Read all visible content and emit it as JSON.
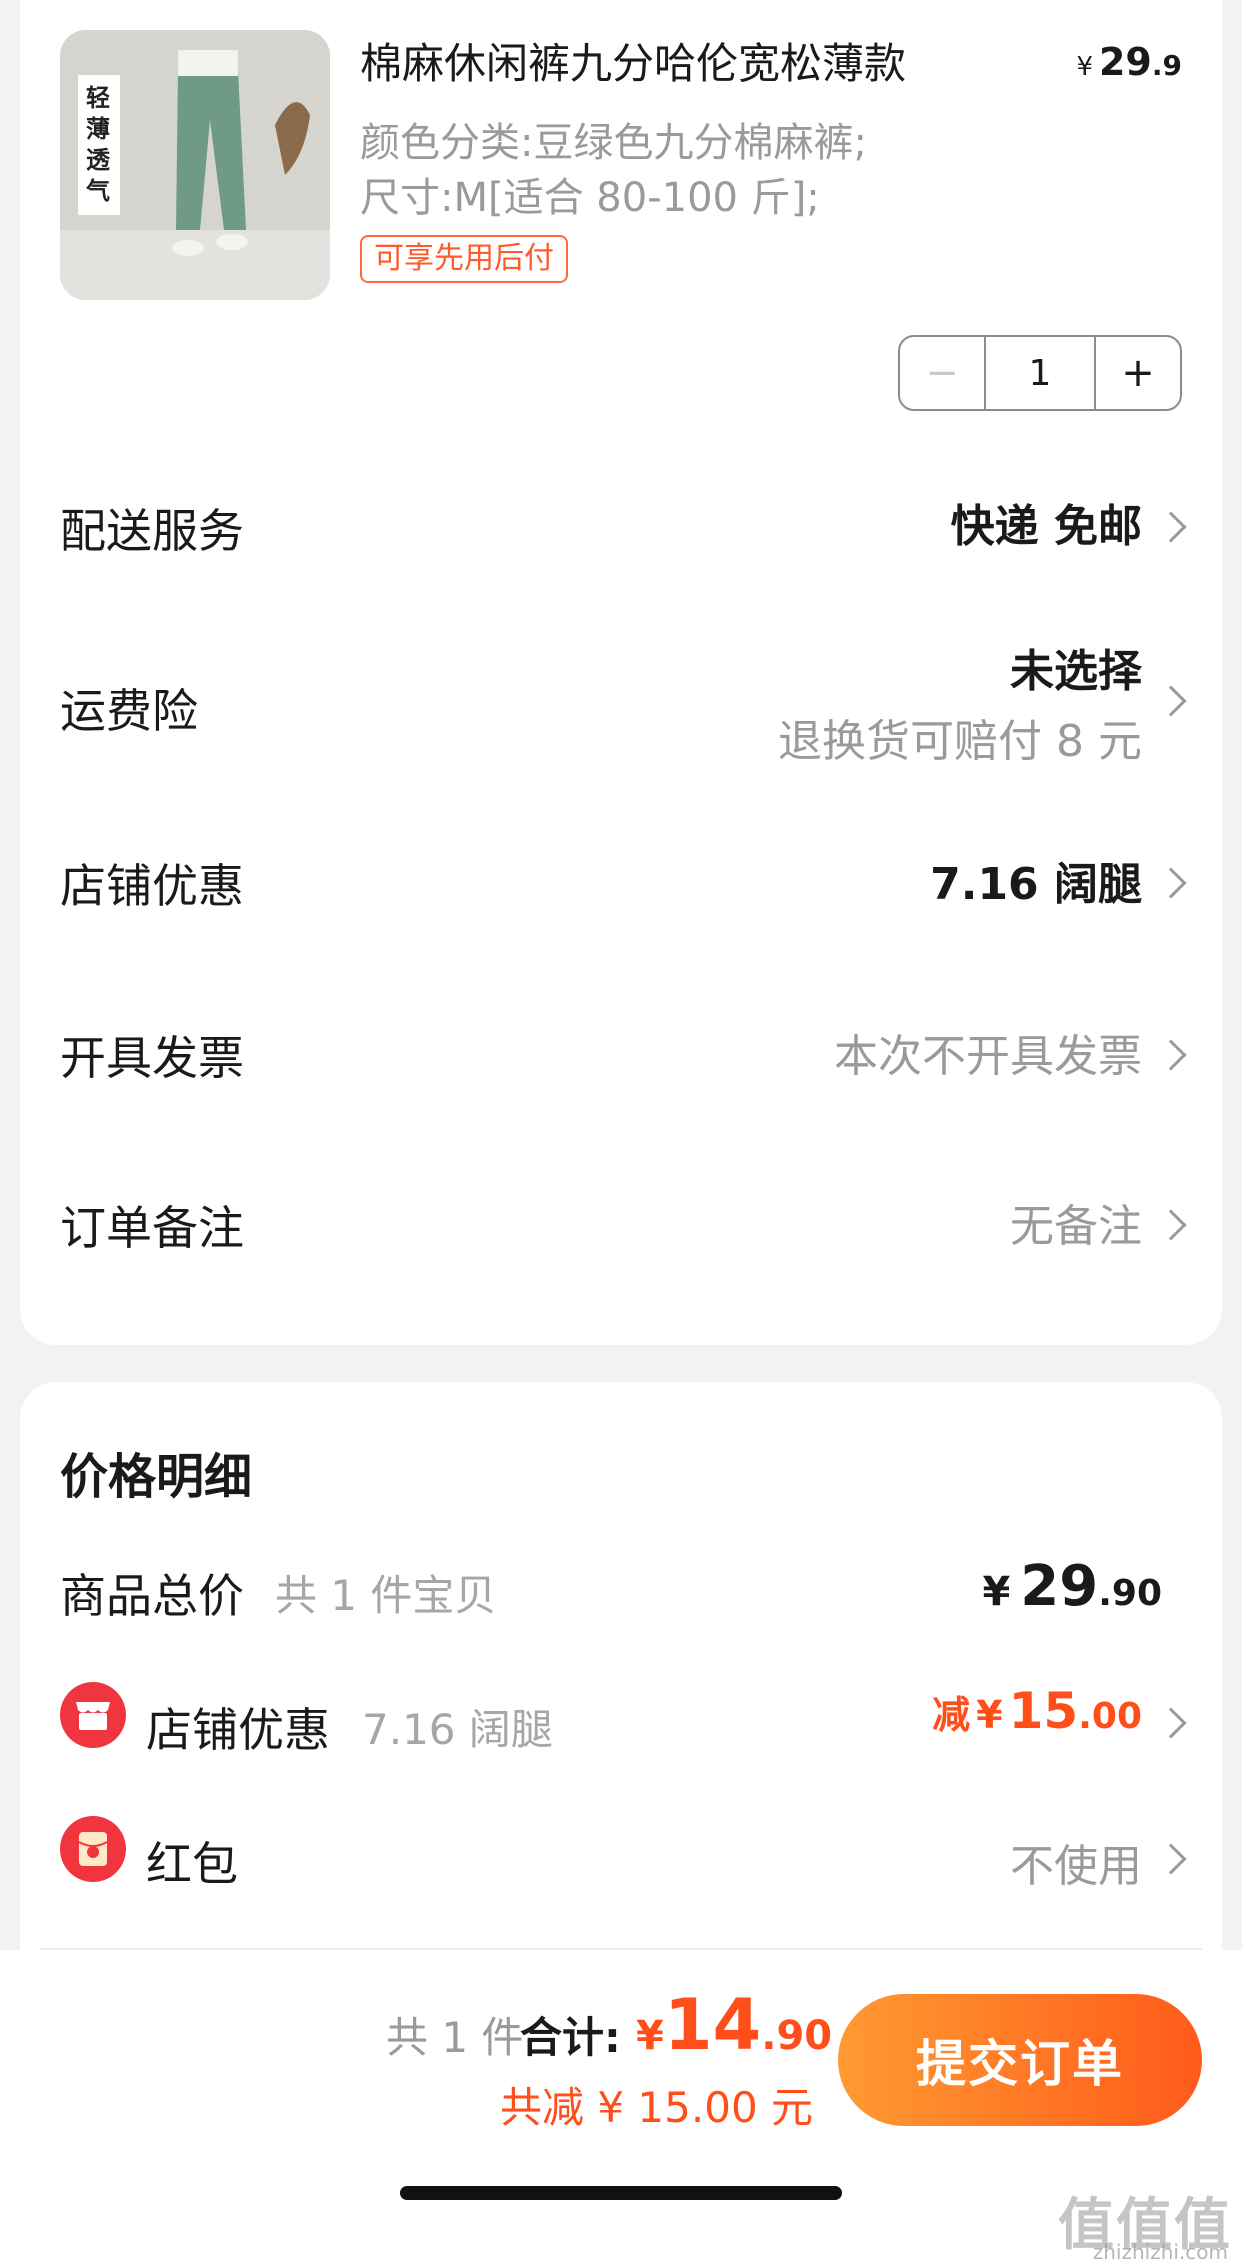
{
  "product": {
    "title": "棉麻休闲裤九分哈伦宽松薄款",
    "spec_color": "颜色分类:豆绿色九分棉麻裤;",
    "spec_size": "尺寸:M[适合 80-100 斤];",
    "price_symbol": "¥",
    "price_int": "29",
    "price_dec": ".9",
    "tag": "可享先用后付",
    "image_text": "轻薄透气",
    "quantity": "1",
    "minus_symbol": "−",
    "plus_symbol": "+"
  },
  "options": {
    "delivery": {
      "label": "配送服务",
      "value": "快递 免邮"
    },
    "shipping_insurance": {
      "label": "运费险",
      "value": "未选择",
      "sub": "退换货可赔付 8 元"
    },
    "shop_discount": {
      "label": "店铺优惠",
      "value": "7.16 阔腿"
    },
    "invoice": {
      "label": "开具发票",
      "value": "本次不开具发票"
    },
    "note": {
      "label": "订单备注",
      "value": "无备注"
    }
  },
  "price_detail": {
    "title": "价格明细",
    "goods_total": {
      "label": "商品总价",
      "sub": "共 1 件宝贝",
      "symbol": "¥",
      "int": "29",
      "dec": ".90"
    },
    "shop_discount": {
      "label": "店铺优惠",
      "sub": "7.16 阔腿",
      "prefix": "减",
      "symbol": "¥",
      "int": "15",
      "dec": ".00"
    },
    "red_packet": {
      "label": "红包",
      "value": "不使用"
    }
  },
  "footer": {
    "count": "共 1 件",
    "total_label": "合计:",
    "total_symbol": "¥",
    "total_int": "14",
    "total_dec": ".90",
    "saved": "共减 ¥ 15.00 元",
    "submit": "提交订单",
    "watermark": "值值值",
    "watermark_url": "zhizhizhi.com"
  },
  "colors": {
    "accent": "#ff4e1a",
    "red_icon": "#f0353f",
    "button_gradient_start": "#ff9a32",
    "button_gradient_end": "#ff5a1a"
  }
}
